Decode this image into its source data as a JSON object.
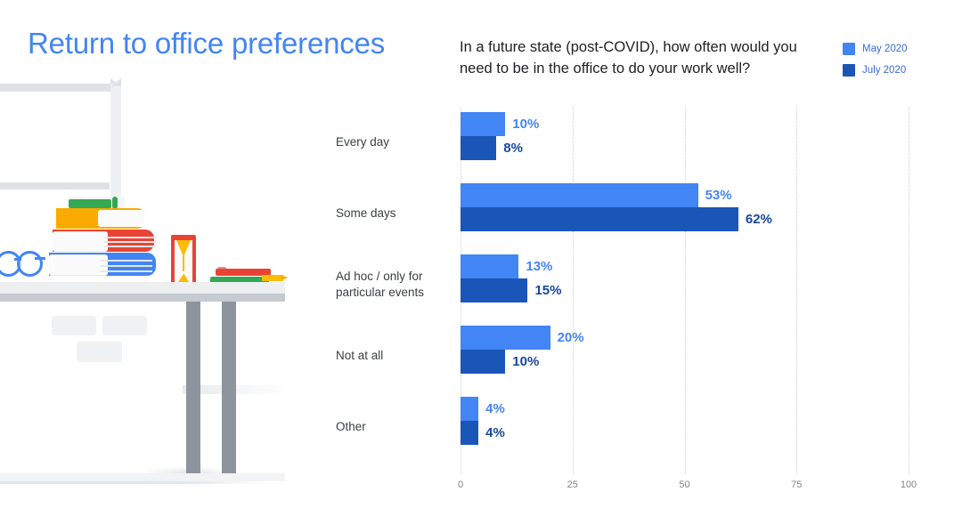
{
  "slide": {
    "title": "Return to office preferences",
    "title_color": "#4285F4",
    "background": "#FFFFFF"
  },
  "chart_header": {
    "question": "In a future state (post-COVID), how often would you need to be in the office to do your work well?"
  },
  "legend": {
    "position": "top-right",
    "items": [
      {
        "label": "May 2020",
        "color": "#4285F4"
      },
      {
        "label": "July 2020",
        "color": "#1A56B8"
      }
    ]
  },
  "chart_data": {
    "type": "bar",
    "orientation": "horizontal",
    "title": "In a future state (post-COVID), how often would you need to be in the office to do your work well?",
    "xlabel": "",
    "ylabel": "",
    "xlim": [
      0,
      100
    ],
    "xticks": [
      "0",
      "25",
      "50",
      "75",
      "100"
    ],
    "grid": true,
    "grid_style": "dotted-vertical",
    "value_suffix": "%",
    "categories": [
      "Every day",
      "Some days",
      "Ad hoc / only for particular events",
      "Not at all",
      "Other"
    ],
    "category_labels": [
      "Every day",
      "Some days",
      "Ad hoc / only for\nparticular events",
      "Not at all",
      "Other"
    ],
    "series": [
      {
        "name": "May 2020",
        "color": "#4285F4",
        "values": [
          10,
          53,
          13,
          20,
          4
        ],
        "labels": [
          "10%",
          "53%",
          "13%",
          "20%",
          "4%"
        ]
      },
      {
        "name": "July 2020",
        "color": "#1A56B8",
        "values": [
          8,
          62,
          15,
          10,
          4
        ],
        "labels": [
          "8%",
          "62%",
          "15%",
          "10%",
          "4%"
        ]
      }
    ]
  },
  "illustration": {
    "name": "desk-with-books-illustration",
    "colors": {
      "shelf": "#DFE1E5",
      "desk": "#EDEFF1",
      "desk_edge": "#C6CAD1",
      "leg": "#8E949E",
      "book_blue": "#4285F4",
      "book_red": "#EA4335",
      "book_yellow": "#F9AB00",
      "book_green": "#34A853",
      "hourglass_frame": "#EA4335",
      "hourglass_sand": "#FBBC04",
      "glasses": "#4285F4"
    }
  }
}
